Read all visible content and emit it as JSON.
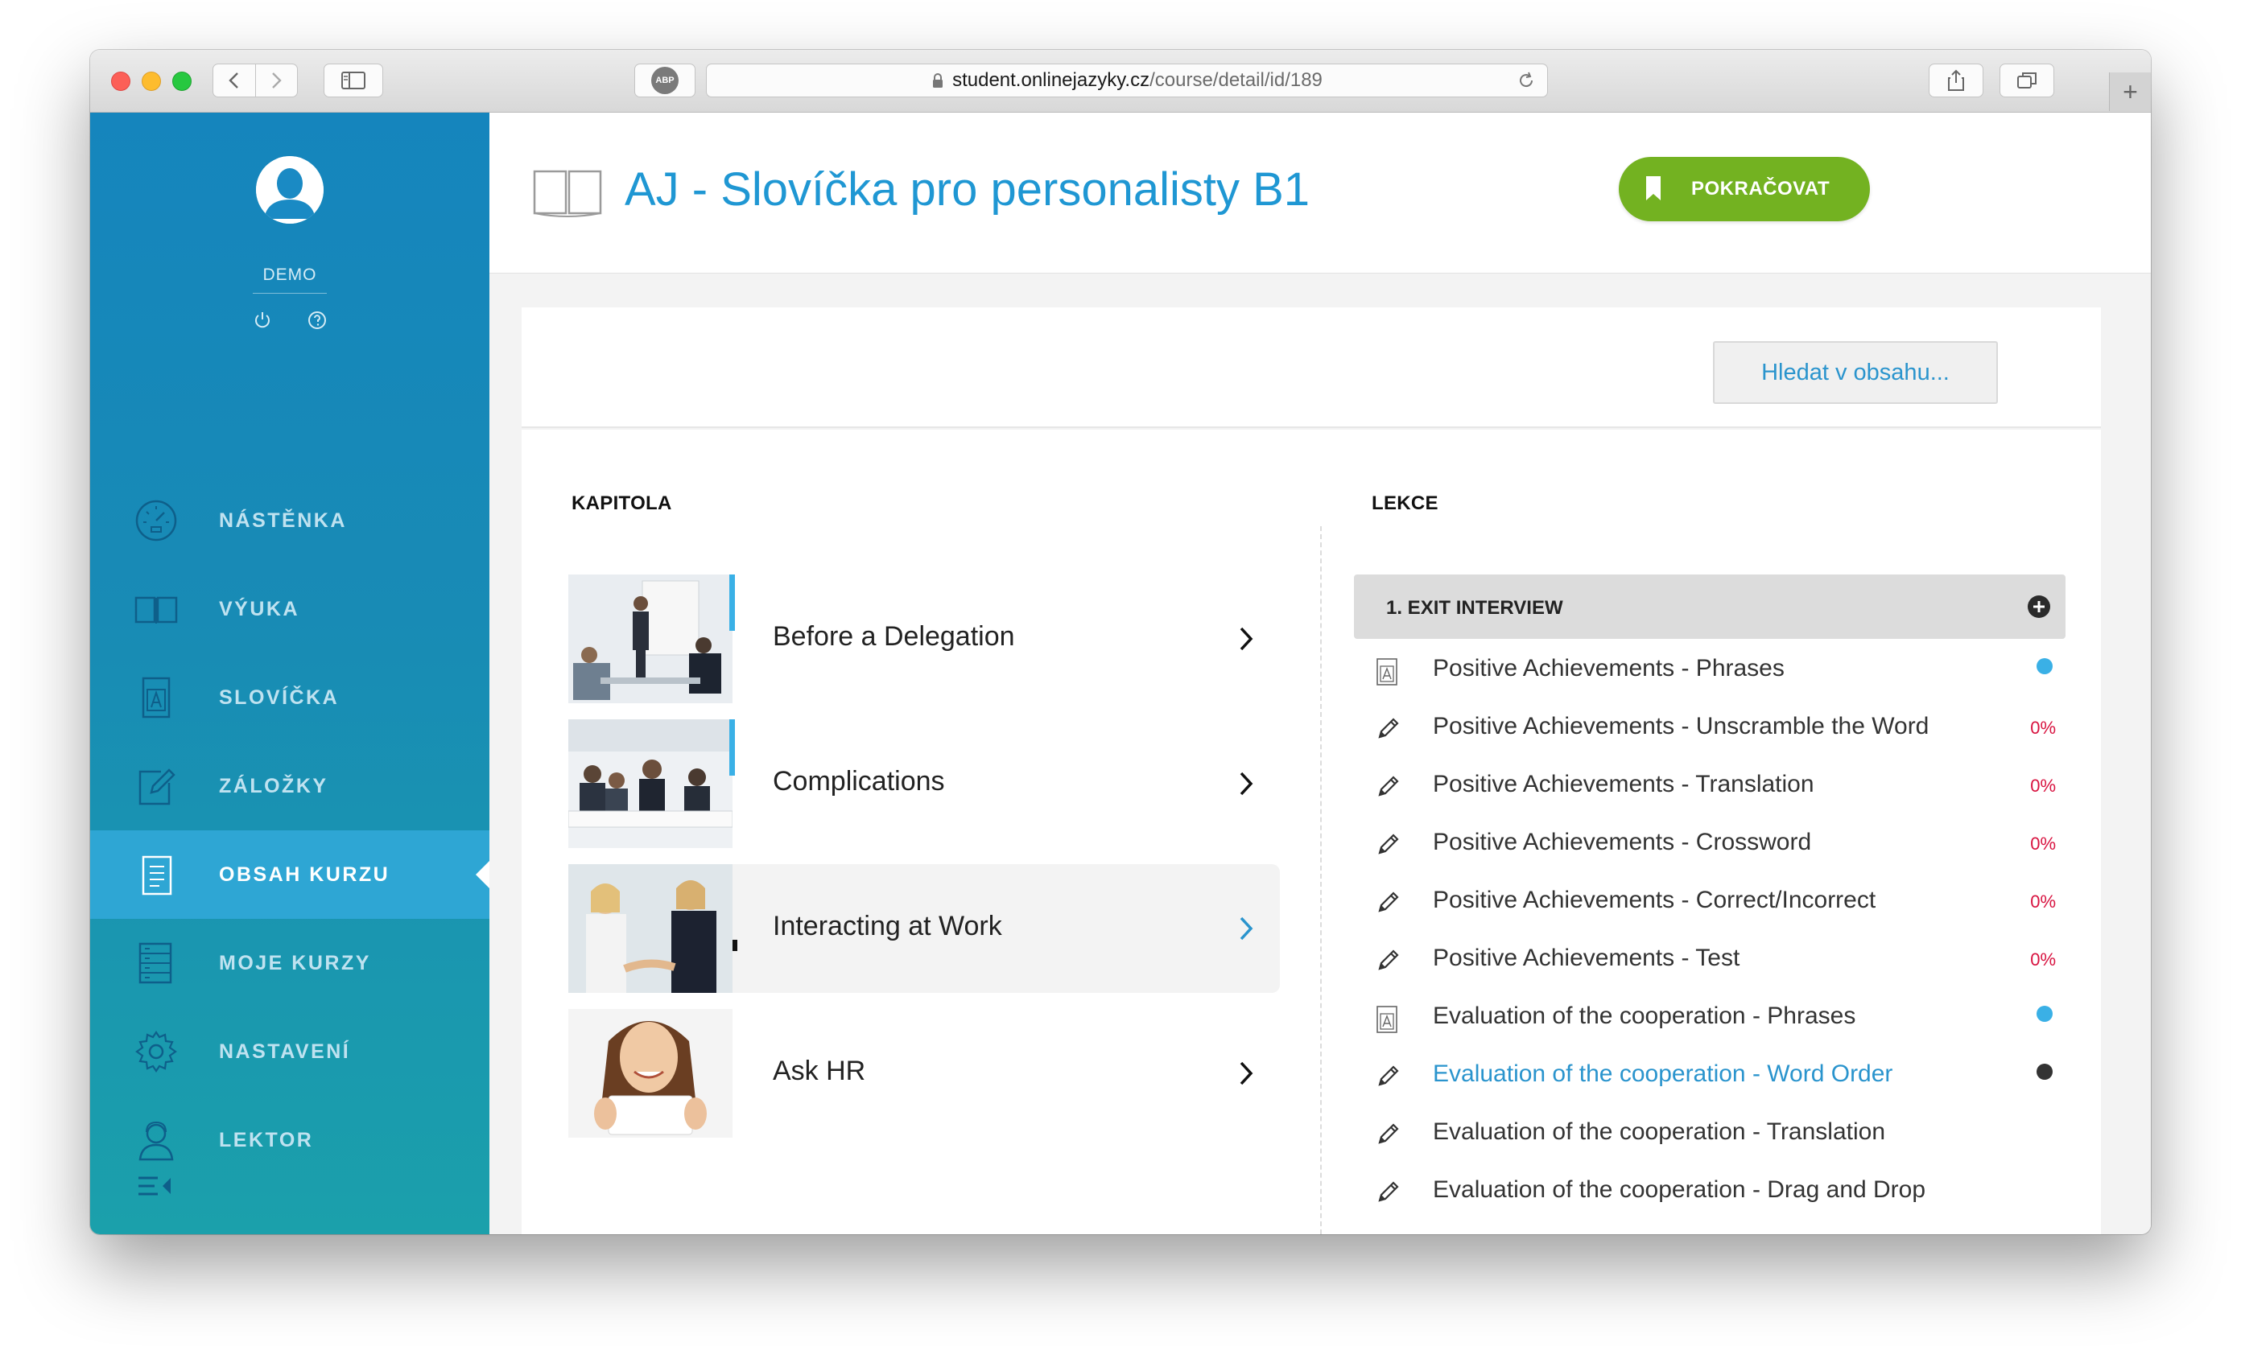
{
  "browser": {
    "domain": "student.onlinejazyky.cz",
    "path": "/course/detail/id/189",
    "adblock_label": "ABP"
  },
  "sidebar": {
    "username": "DEMO",
    "items": [
      {
        "label": "NÁSTĚNKA",
        "icon": "dashboard-gauge-icon",
        "active": false
      },
      {
        "label": "VÝUKA",
        "icon": "open-book-icon",
        "active": false
      },
      {
        "label": "SLOVÍČKA",
        "icon": "vocabulary-card-icon",
        "active": false
      },
      {
        "label": "ZÁLOŽKY",
        "icon": "edit-note-icon",
        "active": false
      },
      {
        "label": "OBSAH KURZU",
        "icon": "document-list-icon",
        "active": true
      },
      {
        "label": "MOJE KURZY",
        "icon": "courses-list-icon",
        "active": false
      },
      {
        "label": "NASTAVENÍ",
        "icon": "gear-icon",
        "active": false
      },
      {
        "label": "LEKTOR",
        "icon": "tutor-person-icon",
        "active": false
      }
    ]
  },
  "header": {
    "course_title": "AJ - Slovíčka pro personalisty B1",
    "continue_label": "POKRAČOVAT"
  },
  "search": {
    "button_label": "Hledat v obsahu..."
  },
  "chapters": {
    "heading": "KAPITOLA",
    "items": [
      {
        "title": "Before a Delegation",
        "selected": false
      },
      {
        "title": "Complications",
        "selected": false
      },
      {
        "title": "Interacting at Work",
        "selected": true
      },
      {
        "title": "Ask HR",
        "selected": false
      }
    ]
  },
  "lessons": {
    "heading": "LEKCE",
    "group_title": "1. EXIT INTERVIEW",
    "items": [
      {
        "title": "Positive Achievements - Phrases",
        "icon": "vocabulary-card-icon",
        "status": "dot",
        "dot_color": "#3ab0e6"
      },
      {
        "title": "Positive Achievements - Unscramble the Word",
        "icon": "pencil-icon",
        "status": "0%"
      },
      {
        "title": "Positive Achievements - Translation",
        "icon": "pencil-icon",
        "status": "0%"
      },
      {
        "title": "Positive Achievements - Crossword",
        "icon": "pencil-icon",
        "status": "0%"
      },
      {
        "title": "Positive Achievements - Correct/Incorrect",
        "icon": "pencil-icon",
        "status": "0%"
      },
      {
        "title": "Positive Achievements - Test",
        "icon": "pencil-icon",
        "status": "0%"
      },
      {
        "title": "Evaluation of the cooperation - Phrases",
        "icon": "vocabulary-card-icon",
        "status": "dot",
        "dot_color": "#3ab0e6"
      },
      {
        "title": "Evaluation of the cooperation - Word Order",
        "icon": "pencil-icon",
        "status": "dot",
        "dot_color": "#333333",
        "current": true
      },
      {
        "title": "Evaluation of the cooperation - Translation",
        "icon": "pencil-icon",
        "status": ""
      },
      {
        "title": "Evaluation of the cooperation - Drag and Drop",
        "icon": "pencil-icon",
        "status": ""
      }
    ]
  },
  "colors": {
    "sidebar_top": "#1585bd",
    "sidebar_bottom": "#1ba0ab",
    "active_item": "#2ea6d4",
    "accent_blue": "#1f97d3",
    "continue_green": "#73b221",
    "progress_red": "#d8123f"
  }
}
